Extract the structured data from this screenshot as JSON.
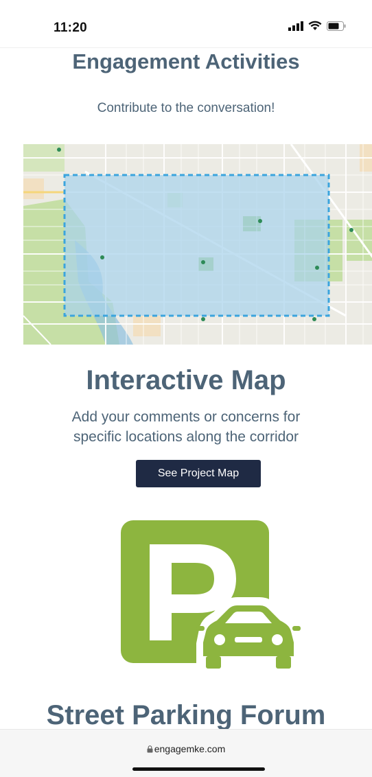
{
  "status_bar": {
    "time": "11:20",
    "icons": [
      "signal-icon",
      "wifi-icon",
      "battery-icon"
    ]
  },
  "page": {
    "section_title": "Engagement Activities",
    "subtitle": "Contribute to the conversation!"
  },
  "interactive_map": {
    "title": "Interactive Map",
    "description_line1": "Add your comments or concerns for",
    "description_line2": "specific locations along the corridor",
    "button_label": "See Project Map"
  },
  "parking": {
    "icon": "parking-car-icon",
    "title": "Street Parking Forum"
  },
  "browser": {
    "url": "engagemke.com"
  },
  "colors": {
    "heading": "#4d6477",
    "button_bg": "#1f2a44",
    "parking_green": "#8db53f",
    "map_highlight": "#a9d3ec",
    "map_border": "#3ba4dd"
  }
}
